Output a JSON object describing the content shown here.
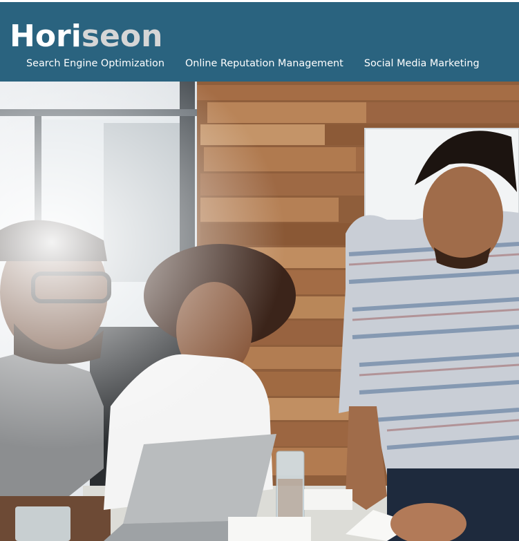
{
  "header": {
    "logo_primary": "Hori",
    "logo_accent": "seon",
    "nav": [
      {
        "label": "Search Engine Optimization"
      },
      {
        "label": "Online Reputation Management"
      },
      {
        "label": "Social Media Marketing"
      }
    ]
  },
  "colors": {
    "header_bg": "#2a637f",
    "logo_text": "#ffffff",
    "logo_accent": "#d6d6d6",
    "nav_text": "#ffffff"
  },
  "hero": {
    "image": "hero-photo-people-at-laptop"
  }
}
